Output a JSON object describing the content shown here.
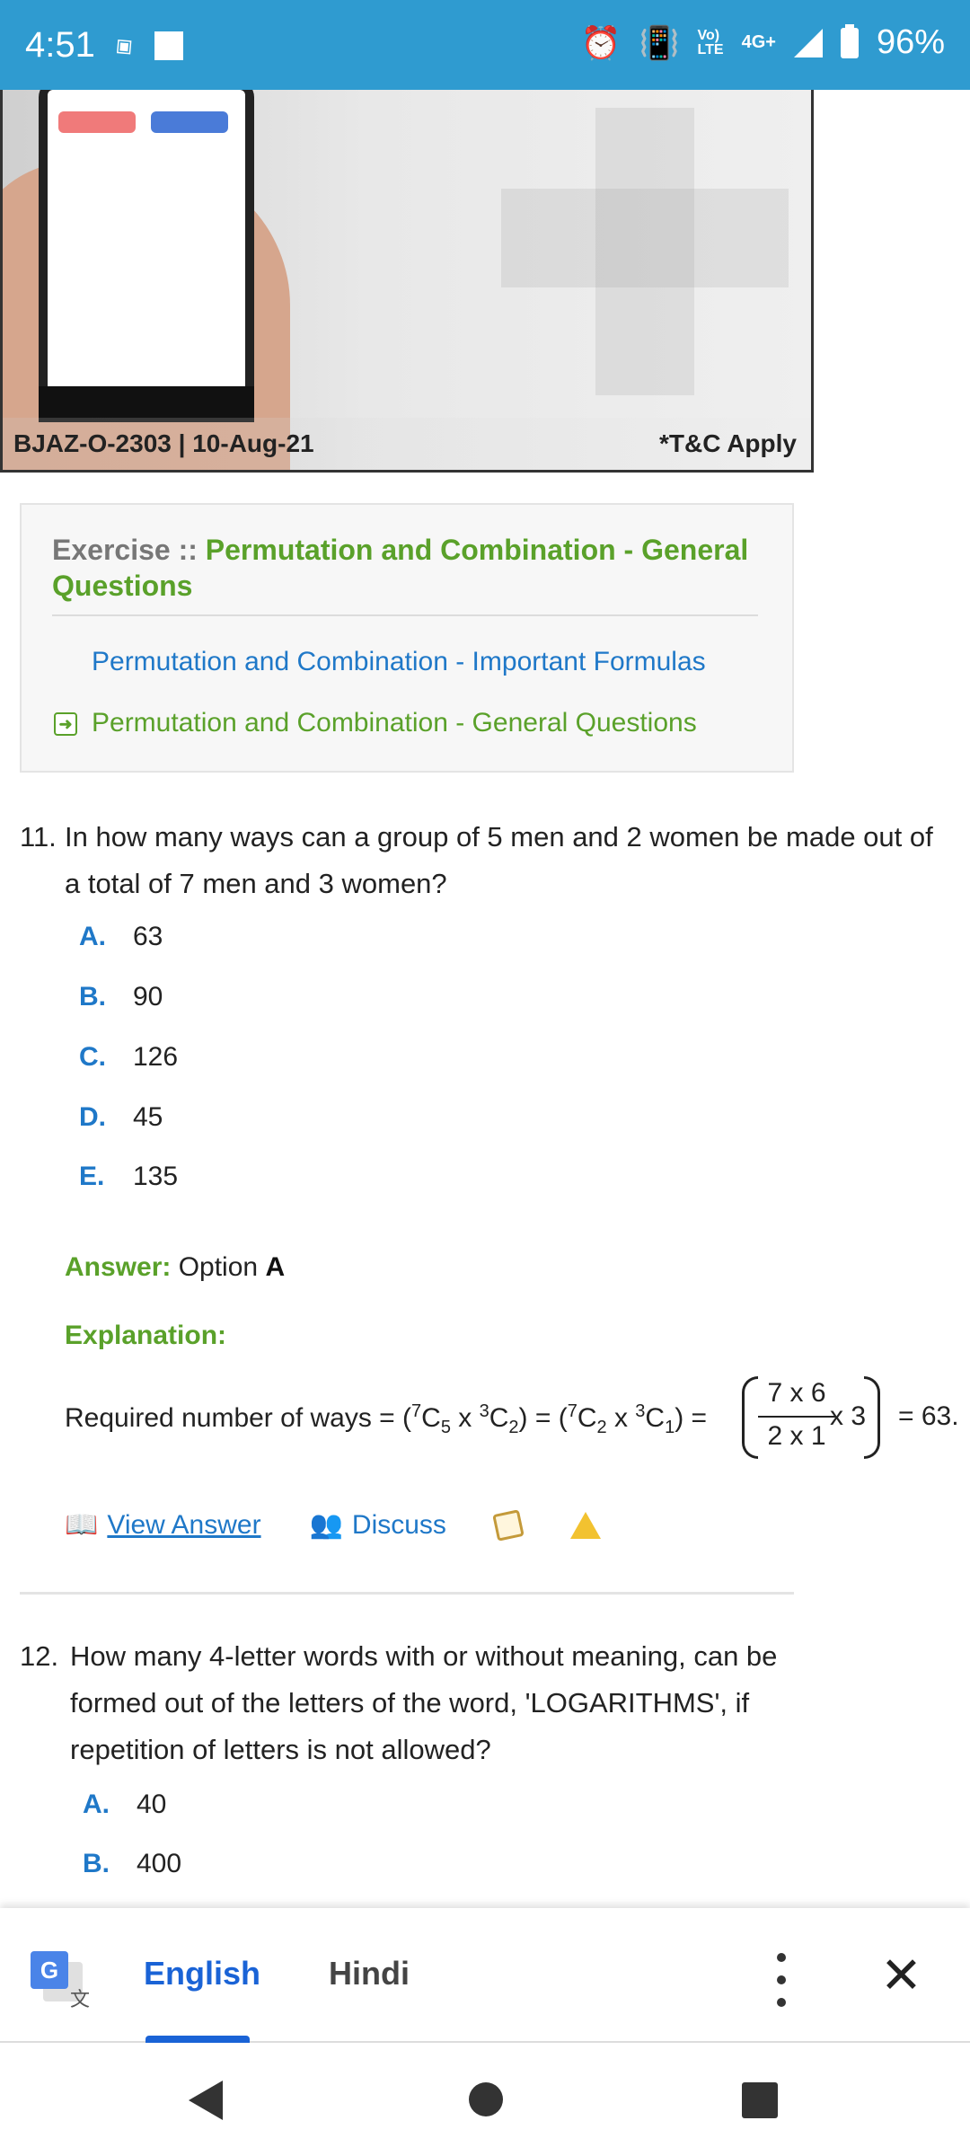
{
  "status_bar": {
    "time": "4:51",
    "lte_line1": "Vo)",
    "lte_line2": "LTE",
    "network": "4G+",
    "battery": "96%"
  },
  "ad": {
    "code": "BJAZ-O-2303 | 10-Aug-21",
    "terms": "*T&C Apply"
  },
  "exercise": {
    "prefix": "Exercise :: ",
    "title": "Permutation and Combination - General Questions",
    "links": [
      "Permutation and Combination - Important Formulas",
      "Permutation and Combination - General Questions"
    ]
  },
  "q11": {
    "number": "11.",
    "text": "In how many ways can a group of 5 men and 2 women be made out of a total of 7 men and 3 women?",
    "options": [
      {
        "letter": "A.",
        "value": "63"
      },
      {
        "letter": "B.",
        "value": "90"
      },
      {
        "letter": "C.",
        "value": "126"
      },
      {
        "letter": "D.",
        "value": "45"
      },
      {
        "letter": "E.",
        "value": "135"
      }
    ],
    "answer_label": "Answer:",
    "answer_text": "Option",
    "answer_option": "A",
    "explanation_label": "Explanation:",
    "formula_lead": "Required number of ways = (",
    "frac_top": "7 x 6",
    "frac_bottom": "2 x 1",
    "frac_mult": "x 3",
    "result": "= 63."
  },
  "actions": {
    "view_answer": "View Answer",
    "discuss": "Discuss"
  },
  "q12": {
    "number": "12.",
    "text": "How many 4-letter words with or without meaning, can be formed out of the letters of the word, 'LOGARITHMS', if repetition of letters is not allowed?",
    "options": [
      {
        "letter": "A.",
        "value": "40"
      },
      {
        "letter": "B.",
        "value": "400"
      }
    ]
  },
  "translate": {
    "lang1": "English",
    "lang2": "Hindi",
    "zh_glyph": "文"
  },
  "colors": {
    "status_bar": "#2f9bd0",
    "accent_blue": "#1f78c8",
    "accent_green": "#5aa12a",
    "translate_blue": "#1a63d6"
  }
}
